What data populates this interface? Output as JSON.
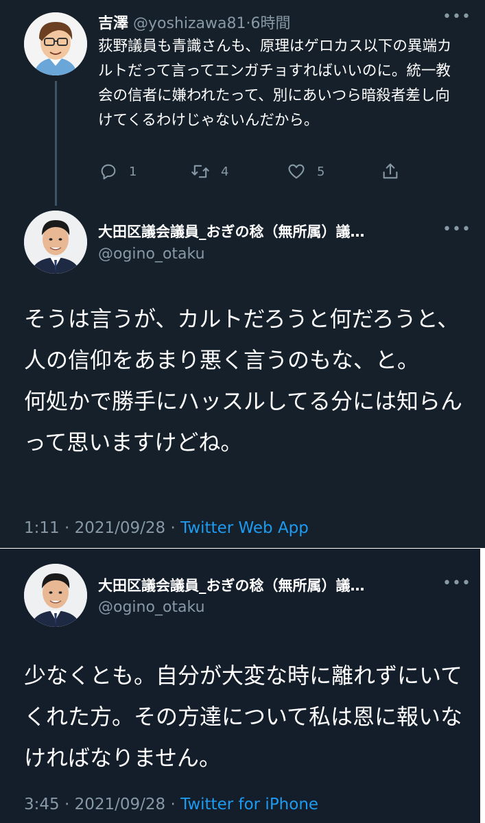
{
  "reply": {
    "display_name": "吉澤",
    "handle": "@yoshizawa81",
    "time": "6時間",
    "text": "荻野議員も青識さんも、原理はゲロカス以下の異端カルトだって言ってエンガチョすればいいのに。統一教会の信者に嫌われたって、別にあいつら暗殺者差し向けてくるわけじゃないんだから。",
    "reply_count": "1",
    "retweet_count": "4",
    "like_count": "5"
  },
  "tweet1": {
    "display_name": "大田区議会議員_おぎの稔（無所属）議…",
    "handle": "@ogino_otaku",
    "text": "そうは言うが、カルトだろうと何だろうと、人の信仰をあまり悪く言うのもな、と。\n何処かで勝手にハッスルしてる分には知らんって思いますけどね。",
    "time": "1:11 · 2021/09/28 · ",
    "source": "Twitter Web App"
  },
  "tweet2": {
    "display_name": "大田区議会議員_おぎの稔（無所属）議…",
    "handle": "@ogino_otaku",
    "text": "少なくとも。自分が大変な時に離れずにいてくれた方。その方達について私は恩に報いなければなりません。",
    "time": "3:45 · 2021/09/28 · ",
    "source": "Twitter for iPhone"
  },
  "icons": {
    "more": "more-icon",
    "reply": "reply-icon",
    "retweet": "retweet-icon",
    "like": "heart-icon",
    "share": "share-icon"
  },
  "colors": {
    "background": "#15202b",
    "secondary_text": "#8899a6",
    "link": "#1d9bf0",
    "thread_line": "#3d5466"
  }
}
